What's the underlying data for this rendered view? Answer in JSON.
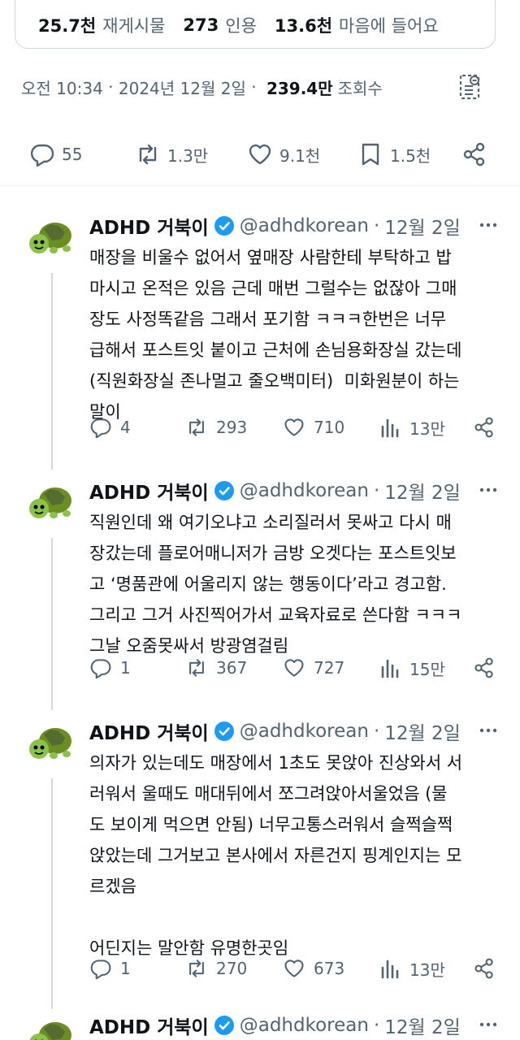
{
  "top_stats": {
    "reposts_value": "25.7천",
    "reposts_label": "재게시물",
    "quotes_value": "273",
    "quotes_label": "인용",
    "likes_value": "13.6천",
    "likes_label": "마음에 들어요"
  },
  "post_meta": {
    "time": "오전 10:34",
    "separator": " · ",
    "date": "2024년 12월 2일",
    "separator2": " · ",
    "views_value": "239.4만",
    "views_label": "조회수"
  },
  "actions": {
    "replies": "55",
    "reposts": "1.3만",
    "likes": "9.1천",
    "bookmarks": "1.5천"
  },
  "colors": {
    "text": "#0f1419",
    "muted": "#536471",
    "verified": "#1d9bf0",
    "divider": "#eff3f4"
  },
  "replies": [
    {
      "name": "ADHD 거북이",
      "handle": "@adhdkorean",
      "date": "12월 2일",
      "text": "매장을 비울수 없어서 옆매장 사람한테 부탁하고 밥\n마시고 온적은 있음 근데 매번 그럴수는 없잖아 그매\n장도 사정똑같음 그래서 포기함 ㅋㅋㅋ한번은 너무\n급해서 포스트잇 붙이고 근처에 손님용화장실 갔는데\n(직원화장실 존나멀고 줄오백미터)  미화원분이 하는\n말이",
      "replies": "4",
      "reposts": "293",
      "likes": "710",
      "views": "13만"
    },
    {
      "name": "ADHD 거북이",
      "handle": "@adhdkorean",
      "date": "12월 2일",
      "text": "직원인데 왜 여기오냐고 소리질러서 못싸고 다시 매\n장갔는데 플로어매니저가 금방 오겟다는 포스트잇보\n고 ‘명품관에 어울리지 않는 행동이다’라고 경고함.\n그리고 그거 사진찍어가서 교육자료로 쓴다함 ㅋㅋㅋ\n그날 오줌못싸서 방광염걸림",
      "replies": "1",
      "reposts": "367",
      "likes": "727",
      "views": "15만"
    },
    {
      "name": "ADHD 거북이",
      "handle": "@adhdkorean",
      "date": "12월 2일",
      "text": "의자가 있는데도 매장에서 1초도 못앉아 진상와서 서\n러워서 울때도 매대뒤에서 쪼그려앉아서울었음 (물\n도 보이게 먹으면 안됨) 너무고통스러워서 슬쩍슬쩍\n앉았는데 그거보고 본사에서 자른건지 핑계인지는 모\n르겠음\n\n어딘지는 말안함 유명한곳임",
      "replies": "1",
      "reposts": "270",
      "likes": "673",
      "views": "13만"
    },
    {
      "name": "ADHD 거북이",
      "handle": "@adhdkorean",
      "date": "12월 2일"
    }
  ]
}
